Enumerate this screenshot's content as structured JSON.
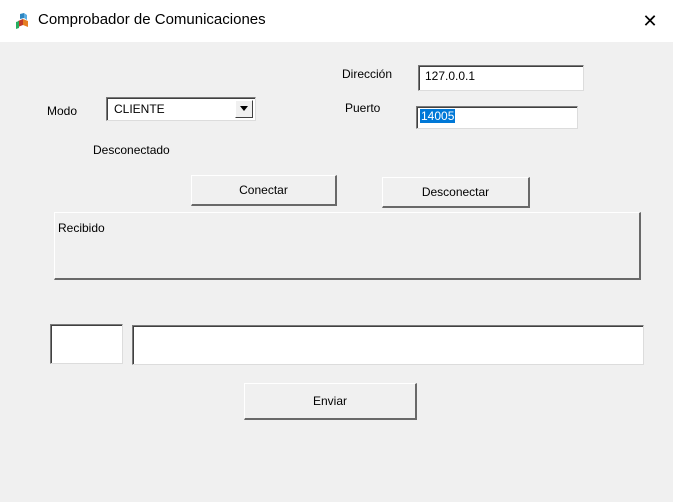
{
  "window": {
    "title": "Comprobador de Comunicaciones",
    "close_glyph": "✕",
    "icon": "app-cubes-icon"
  },
  "connection": {
    "direccion_label": "Dirección",
    "direccion_value": "127.0.0.1",
    "puerto_label": "Puerto",
    "puerto_value": "14005",
    "modo_label": "Modo",
    "modo_value": "CLIENTE",
    "status": "Desconectado"
  },
  "buttons": {
    "conectar": "Conectar",
    "desconectar": "Desconectar",
    "enviar": "Enviar"
  },
  "received": {
    "label": "Recibido"
  },
  "send": {
    "small_field_value": "",
    "message_value": ""
  },
  "colors": {
    "selection": "#0078d7",
    "window_bg": "#f0f0f0",
    "titlebar_bg": "#ffffff"
  }
}
